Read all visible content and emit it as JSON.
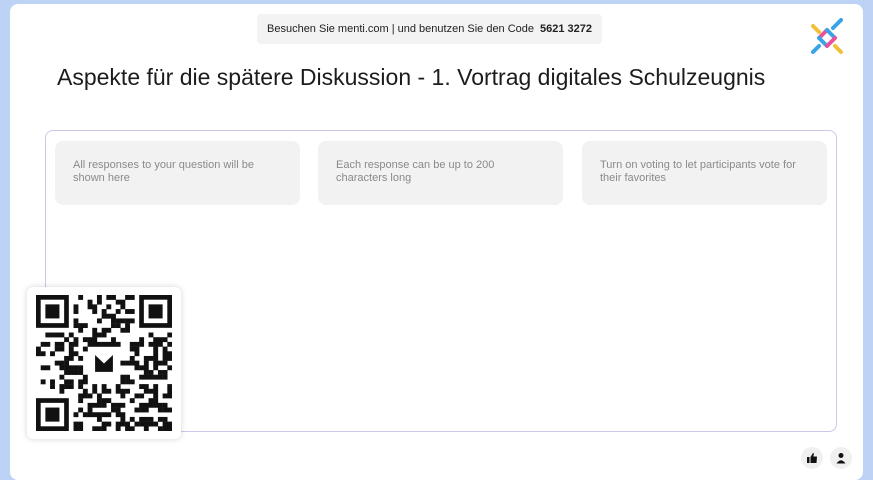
{
  "join": {
    "prefix": "Besuchen Sie menti.com | und benutzen Sie den Code",
    "code": "5621 3272"
  },
  "title": "Aspekte für die spätere Diskussion -  1. Vortrag digitales Schulzeugnis",
  "cards": [
    {
      "text": "All responses to your question will be shown here"
    },
    {
      "text": "Each response can be up to 200 characters long"
    },
    {
      "text": "Turn on voting to let participants vote for their favorites"
    }
  ],
  "icons": {
    "logo": "mentimeter-logo-icon",
    "qr": "qr-code-icon",
    "reactions": "thumbs-up-icon",
    "participants": "person-icon"
  },
  "colors": {
    "page_background": "#bcd3f5",
    "board_border": "#c9c9e8",
    "card_background": "#f2f2f2",
    "logo_blue": "#3aa3e8",
    "logo_pink": "#e8529a",
    "logo_yellow": "#f2c037"
  }
}
